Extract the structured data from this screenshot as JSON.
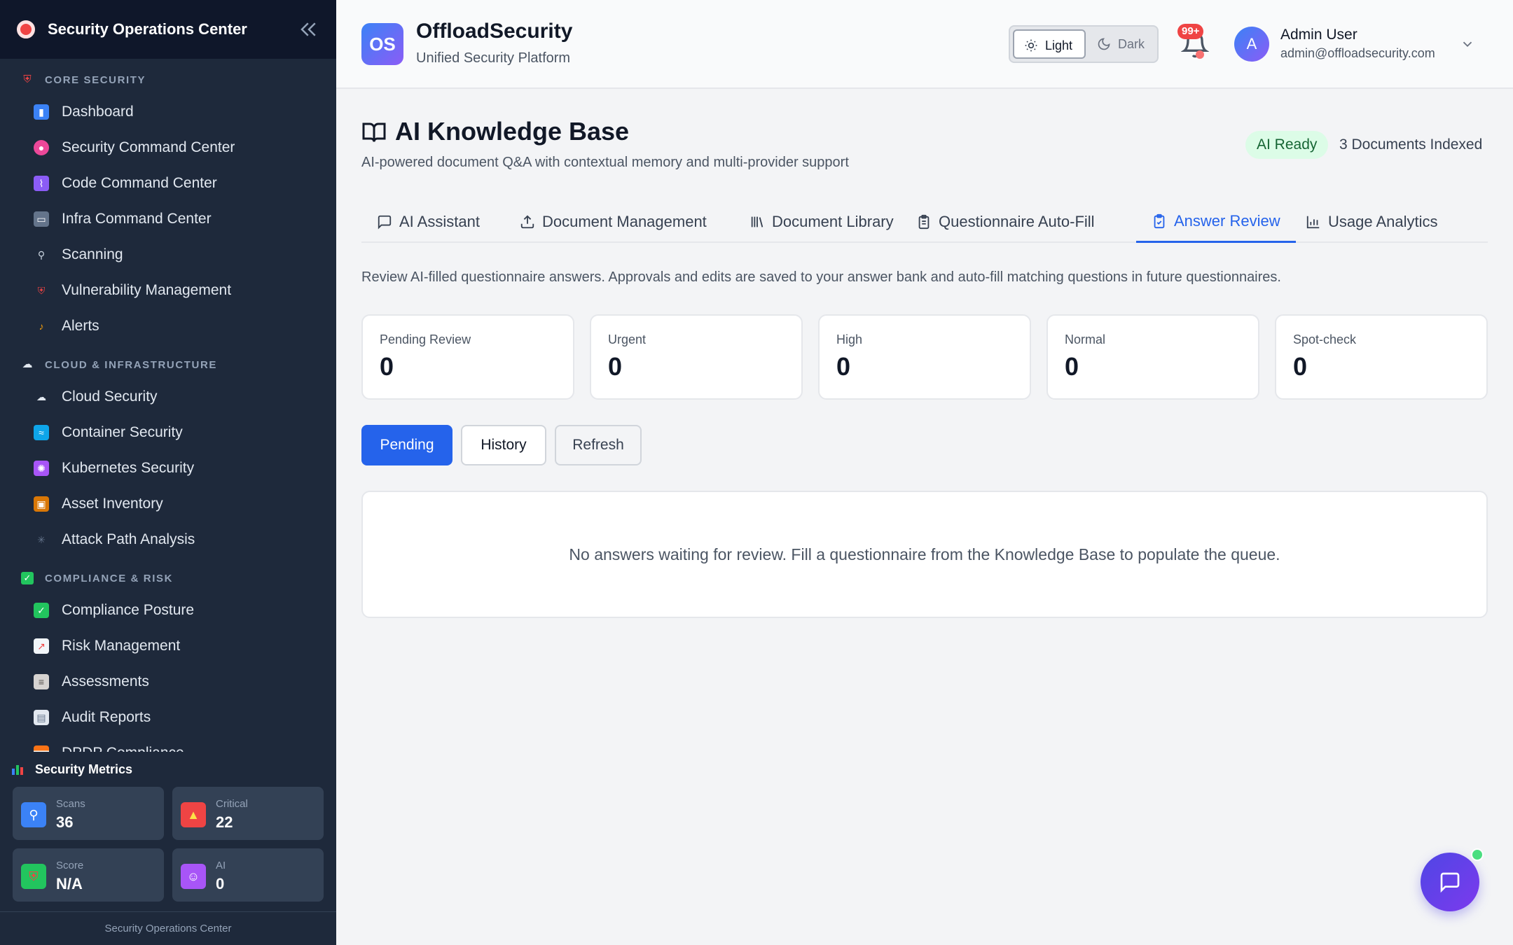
{
  "sidebar": {
    "title": "Security Operations Center",
    "sections": [
      {
        "label": "CORE SECURITY",
        "icon": "shield-icon",
        "items": [
          {
            "label": "Dashboard",
            "icon": "bar-chart-icon",
            "color": "#3b82f6"
          },
          {
            "label": "Security Command Center",
            "icon": "brain-icon",
            "color": "#ec4899"
          },
          {
            "label": "Code Command Center",
            "icon": "dna-icon",
            "color": "#8b5cf6"
          },
          {
            "label": "Infra Command Center",
            "icon": "monitor-icon",
            "color": "#64748b"
          },
          {
            "label": "Scanning",
            "icon": "magnifier-icon",
            "color": "#94a3b8"
          },
          {
            "label": "Vulnerability Management",
            "icon": "shield-icon",
            "color": "#ef4444"
          },
          {
            "label": "Alerts",
            "icon": "bell-icon",
            "color": "#f59e0b"
          }
        ]
      },
      {
        "label": "CLOUD & INFRASTRUCTURE",
        "icon": "cloud-icon",
        "items": [
          {
            "label": "Cloud Security",
            "icon": "cloud-icon",
            "color": "#cbd5e1"
          },
          {
            "label": "Container Security",
            "icon": "whale-icon",
            "color": "#0ea5e9"
          },
          {
            "label": "Kubernetes Security",
            "icon": "atom-icon",
            "color": "#a855f7"
          },
          {
            "label": "Asset Inventory",
            "icon": "package-icon",
            "color": "#d97706"
          },
          {
            "label": "Attack Path Analysis",
            "icon": "network-icon",
            "color": "#475569"
          }
        ]
      },
      {
        "label": "COMPLIANCE & RISK",
        "icon": "check-box-icon",
        "items": [
          {
            "label": "Compliance Posture",
            "icon": "check-box-icon",
            "color": "#22c55e"
          },
          {
            "label": "Risk Management",
            "icon": "trend-chart-icon",
            "color": "#f1f5f9"
          },
          {
            "label": "Assessments",
            "icon": "clipboard-icon",
            "color": "#d6d3d1"
          },
          {
            "label": "Audit Reports",
            "icon": "document-icon",
            "color": "#e2e8f0"
          },
          {
            "label": "DPDP Compliance",
            "icon": "flag-icon",
            "color": "#f97316"
          }
        ]
      }
    ],
    "metrics": {
      "title": "Security Metrics",
      "cards": [
        {
          "label": "Scans",
          "value": "36",
          "icon": "magnifier-icon",
          "color": "#3b82f6"
        },
        {
          "label": "Critical",
          "value": "22",
          "icon": "warning-icon",
          "color": "#ef4444"
        },
        {
          "label": "Score",
          "value": "N/A",
          "icon": "shield-icon",
          "color": "#22c55e"
        },
        {
          "label": "AI",
          "value": "0",
          "icon": "robot-icon",
          "color": "#a855f7"
        }
      ]
    },
    "footer": "Security Operations Center"
  },
  "header": {
    "logo_text": "OS",
    "brand": "OffloadSecurity",
    "subtitle": "Unified Security Platform",
    "theme_light": "Light",
    "theme_dark": "Dark",
    "notifications_badge": "99+",
    "user_initial": "A",
    "user_name": "Admin User",
    "user_email": "admin@offloadsecurity.com"
  },
  "page": {
    "title": "AI Knowledge Base",
    "subtitle": "AI-powered document Q&A with contextual memory and multi-provider support",
    "status_badge": "AI Ready",
    "docs_indexed": "3 Documents Indexed",
    "tabs": [
      {
        "label": "AI Assistant",
        "icon": "chat-bubble-icon",
        "active": false
      },
      {
        "label": "Document Management",
        "icon": "upload-icon",
        "active": false
      },
      {
        "label": "Document Library",
        "icon": "library-icon",
        "active": false
      },
      {
        "label": "Questionnaire Auto-Fill",
        "icon": "clipboard-icon",
        "active": false
      },
      {
        "label": "Answer Review",
        "icon": "clipboard-check-icon",
        "active": true
      },
      {
        "label": "Usage Analytics",
        "icon": "bar-chart-icon",
        "active": false
      }
    ],
    "description": "Review AI-filled questionnaire answers. Approvals and edits are saved to your answer bank and auto-fill matching questions in future questionnaires.",
    "stats": [
      {
        "label": "Pending Review",
        "value": "0"
      },
      {
        "label": "Urgent",
        "value": "0"
      },
      {
        "label": "High",
        "value": "0"
      },
      {
        "label": "Normal",
        "value": "0"
      },
      {
        "label": "Spot-check",
        "value": "0"
      }
    ],
    "buttons": {
      "pending": "Pending",
      "history": "History",
      "refresh": "Refresh"
    },
    "empty_message": "No answers waiting for review. Fill a questionnaire from the Knowledge Base to populate the queue."
  },
  "colors": {
    "accent": "#2563eb",
    "sidebar_bg": "#1e293b",
    "ready_green": "#166534"
  }
}
